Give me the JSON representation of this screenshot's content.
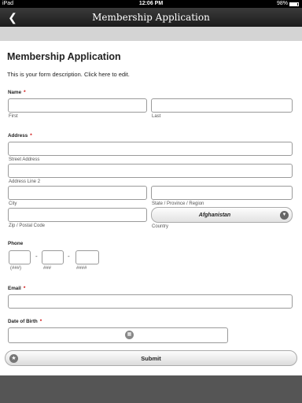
{
  "status_bar": {
    "device": "iPad",
    "time": "12:06 PM",
    "battery": "98%"
  },
  "nav": {
    "title": "Membership Application"
  },
  "form": {
    "title": "Membership Application",
    "description": "This is your form description. Click here to edit.",
    "required_mark": "*",
    "name": {
      "label": "Name",
      "first": "First",
      "last": "Last"
    },
    "address": {
      "label": "Address",
      "street": "Street Address",
      "line2": "Address Line 2",
      "city": "City",
      "state": "State / Province / Region",
      "zip": "Zip / Postal Code",
      "country": "Country",
      "country_value": "Afghanistan"
    },
    "phone": {
      "label": "Phone",
      "dash": "-",
      "part1": "(###)",
      "part2": "###",
      "part3": "####"
    },
    "email": {
      "label": "Email"
    },
    "dob": {
      "label": "Date of Birth"
    },
    "submit": "Submit"
  }
}
